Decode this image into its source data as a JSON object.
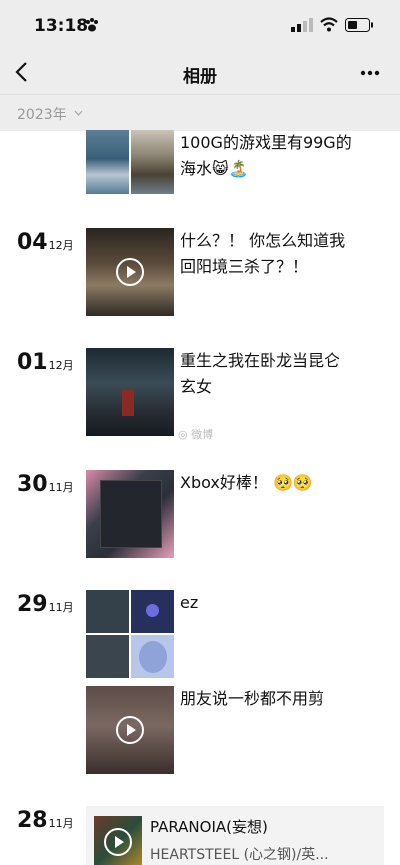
{
  "status": {
    "time": "13:18"
  },
  "nav": {
    "title": "相册"
  },
  "year": "2023年",
  "entries": [
    {
      "caption_lines": [
        "100G的游戏里有99G的",
        "海水😸🏝️"
      ]
    },
    {
      "day": "04",
      "month": "12月",
      "caption_lines": [
        "什么？！ 你怎么知道我",
        "回阳境三杀了？！"
      ]
    },
    {
      "day": "01",
      "month": "12月",
      "caption_lines": [
        "重生之我在卧龙当昆仑",
        "玄女"
      ]
    },
    {
      "day": "30",
      "month": "11月",
      "caption_lines": [
        "Xbox好棒！ 🥺🥺"
      ]
    },
    {
      "day": "29",
      "month": "11月",
      "caption_lines": [
        "ez"
      ]
    },
    {
      "caption_lines": [
        "朋友说一秒都不用剪"
      ]
    },
    {
      "day": "28",
      "month": "11月"
    }
  ],
  "music": {
    "title": "PARANOIA(妄想)",
    "artist": "HEARTSTEEL (心之钢)/英..."
  }
}
